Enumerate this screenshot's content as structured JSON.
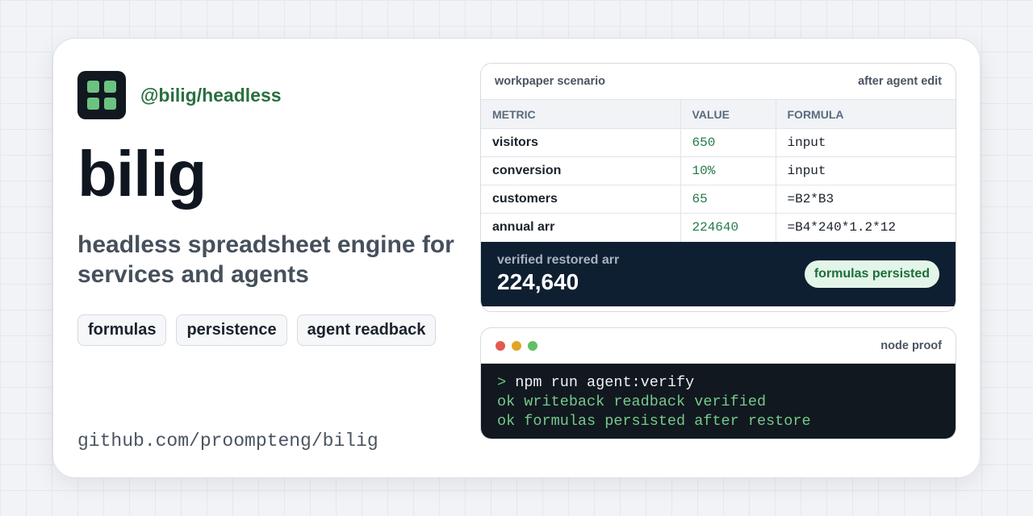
{
  "brand": {
    "package": "@bilig/headless",
    "title": "bilig",
    "tagline": "headless spreadsheet engine for services and agents",
    "logo_icon": "grid-icon",
    "accent": "#6cc281"
  },
  "tags": [
    "formulas",
    "persistence",
    "agent readback"
  ],
  "repo": "github.com/proompteng/bilig",
  "sheet": {
    "title": "workpaper scenario",
    "status": "after agent edit",
    "columns": [
      "METRIC",
      "VALUE",
      "FORMULA"
    ],
    "rows": [
      {
        "metric": "visitors",
        "value": "650",
        "formula": "input"
      },
      {
        "metric": "conversion",
        "value": "10%",
        "formula": "input"
      },
      {
        "metric": "customers",
        "value": "65",
        "formula": "=B2*B3"
      },
      {
        "metric": "annual arr",
        "value": "224640",
        "formula": "=B4*240*1.2*12"
      }
    ],
    "footer": {
      "label": "verified restored arr",
      "value": "224,640",
      "badge": "formulas persisted"
    }
  },
  "terminal": {
    "title": "node proof",
    "dots": [
      "#e5594f",
      "#e0a526",
      "#62bf65"
    ],
    "prompt": ">",
    "command": "npm run agent:verify",
    "output": [
      "ok writeback readback verified",
      "ok formulas persisted after restore"
    ]
  }
}
